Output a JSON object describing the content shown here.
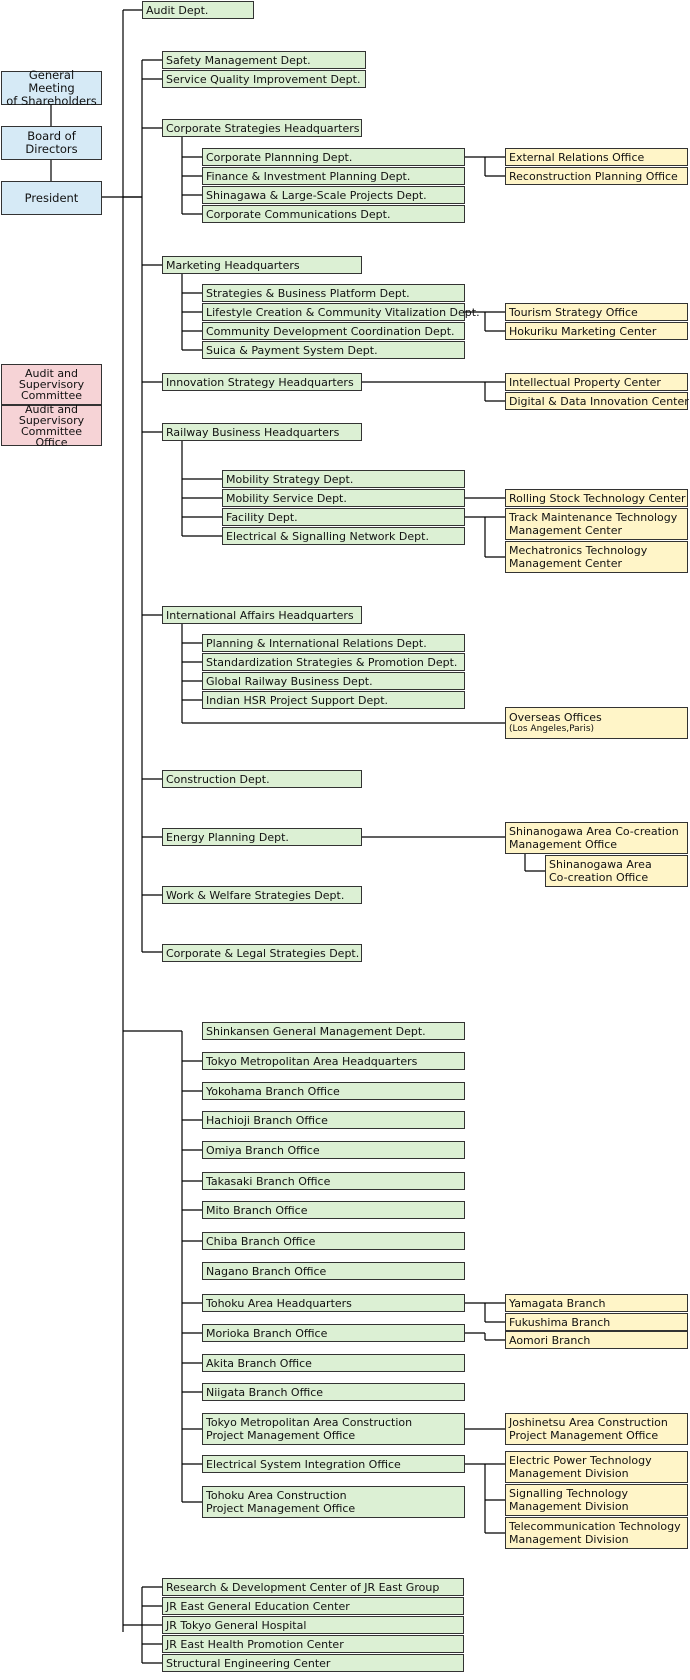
{
  "colors": {
    "department_fill": "#dcf0d4",
    "office_fill": "#fff5c8",
    "governance_fill": "#d6eaf6",
    "audit_fill": "#f6d3d6",
    "line": "#000000"
  },
  "governance": {
    "general_meeting": "General Meeting\nof Shareholders",
    "board": "Board of\nDirectors",
    "president": "President",
    "audit_committee": "Audit and\nSupervisory\nCommittee",
    "audit_committee_office": "Audit and\nSupervisory\nCommittee Office"
  },
  "head_office": {
    "audit_dept": "Audit Dept.",
    "safety": "Safety Management Dept.",
    "service_quality": "Service Quality Improvement Dept.",
    "corporate_strategies": {
      "label": "Corporate Strategies Headquarters",
      "children": [
        "Corporate Plannning Dept.",
        "Finance & Investment Planning Dept.",
        "Shinagawa & Large-Scale Projects Dept.",
        "Corporate Communications Dept."
      ],
      "offices": [
        "External Relations Office",
        "Reconstruction Planning Office"
      ]
    },
    "marketing": {
      "label": "Marketing Headquarters",
      "children": [
        "Strategies & Business Platform Dept.",
        "Lifestyle Creation & Community Vitalization Dept.",
        "Community Development Coordination Dept.",
        "Suica & Payment System Dept."
      ],
      "offices": [
        "Tourism Strategy Office",
        "Hokuriku Marketing Center"
      ]
    },
    "innovation": {
      "label": "Innovation Strategy Headquarters",
      "offices": [
        "Intellectual Property Center",
        "Digital & Data Innovation Center"
      ]
    },
    "railway": {
      "label": "Railway Business Headquarters",
      "children": [
        "Mobility Strategy Dept.",
        "Mobility Service Dept.",
        "Facility Dept.",
        "Electrical & Signalling Network Dept."
      ],
      "offices": [
        "Rolling Stock Technology Center",
        "Track Maintenance Technology\nManagement Center",
        "Mechatronics Technology\nManagement Center"
      ]
    },
    "international": {
      "label": "International Affairs Headquarters",
      "children": [
        "Planning & International Relations Dept.",
        "Standardization Strategies & Promotion Dept.",
        "Global Railway Business Dept.",
        "Indian HSR Project Support Dept."
      ],
      "overseas": "Overseas Offices",
      "overseas_sub": "(Los Angeles,Paris)"
    },
    "construction": "Construction Dept.",
    "energy": {
      "label": "Energy Planning Dept.",
      "offices": [
        "Shinanogawa Area Co-creation\nManagement Office",
        "Shinanogawa Area\nCo-creation Office"
      ]
    },
    "work_welfare": "Work & Welfare Strategies Dept.",
    "corporate_legal": "Corporate & Legal Strategies Dept."
  },
  "branches": {
    "items": [
      "Shinkansen General Management Dept.",
      "Tokyo Metropolitan Area Headquarters",
      "Yokohama Branch Office",
      "Hachioji Branch Office",
      "Omiya Branch Office",
      "Takasaki Branch Office",
      "Mito Branch Office",
      "Chiba Branch Office",
      "Nagano Branch Office",
      "Tohoku Area Headquarters",
      "Morioka Branch Office",
      "Akita Branch Office",
      "Niigata Branch Office",
      "Tokyo  Metropolitan Area Construction\nProject Management Office",
      "Electrical System Integration Office",
      "Tohoku Area Construction\nProject Management Office"
    ],
    "tohoku_offices": [
      "Yamagata Branch",
      "Fukushima Branch"
    ],
    "morioka_offices": [
      "Aomori Branch"
    ],
    "tokyo_construction_offices": [
      "Joshinetsu Area Construction\nProject Management Office"
    ],
    "electrical_offices": [
      "Electric Power Technology\nManagement Division",
      "Signalling Technology\nManagement Division",
      "Telecommunication Technology\nManagement Division"
    ]
  },
  "institutions": [
    "Research & Development Center of JR East Group",
    "JR East General Education Center",
    "JR Tokyo General Hospital",
    "JR East Health Promotion Center",
    "Structural Engineering Center"
  ]
}
